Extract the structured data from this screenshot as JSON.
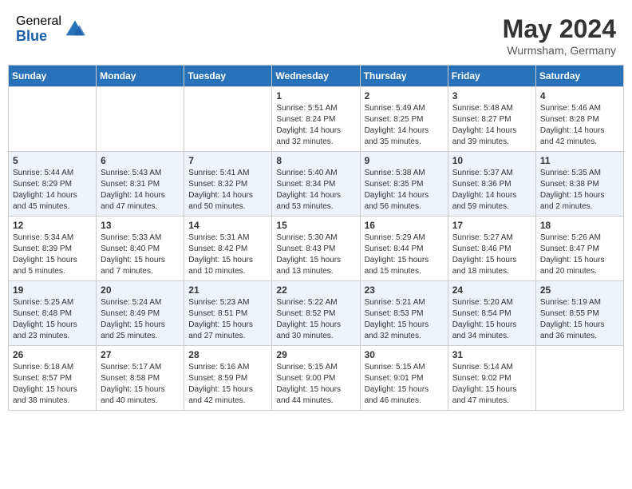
{
  "header": {
    "logo_general": "General",
    "logo_blue": "Blue",
    "month_year": "May 2024",
    "location": "Wurmsham, Germany"
  },
  "weekdays": [
    "Sunday",
    "Monday",
    "Tuesday",
    "Wednesday",
    "Thursday",
    "Friday",
    "Saturday"
  ],
  "weeks": [
    [
      {
        "day": "",
        "info": ""
      },
      {
        "day": "",
        "info": ""
      },
      {
        "day": "",
        "info": ""
      },
      {
        "day": "1",
        "info": "Sunrise: 5:51 AM\nSunset: 8:24 PM\nDaylight: 14 hours\nand 32 minutes."
      },
      {
        "day": "2",
        "info": "Sunrise: 5:49 AM\nSunset: 8:25 PM\nDaylight: 14 hours\nand 35 minutes."
      },
      {
        "day": "3",
        "info": "Sunrise: 5:48 AM\nSunset: 8:27 PM\nDaylight: 14 hours\nand 39 minutes."
      },
      {
        "day": "4",
        "info": "Sunrise: 5:46 AM\nSunset: 8:28 PM\nDaylight: 14 hours\nand 42 minutes."
      }
    ],
    [
      {
        "day": "5",
        "info": "Sunrise: 5:44 AM\nSunset: 8:29 PM\nDaylight: 14 hours\nand 45 minutes."
      },
      {
        "day": "6",
        "info": "Sunrise: 5:43 AM\nSunset: 8:31 PM\nDaylight: 14 hours\nand 47 minutes."
      },
      {
        "day": "7",
        "info": "Sunrise: 5:41 AM\nSunset: 8:32 PM\nDaylight: 14 hours\nand 50 minutes."
      },
      {
        "day": "8",
        "info": "Sunrise: 5:40 AM\nSunset: 8:34 PM\nDaylight: 14 hours\nand 53 minutes."
      },
      {
        "day": "9",
        "info": "Sunrise: 5:38 AM\nSunset: 8:35 PM\nDaylight: 14 hours\nand 56 minutes."
      },
      {
        "day": "10",
        "info": "Sunrise: 5:37 AM\nSunset: 8:36 PM\nDaylight: 14 hours\nand 59 minutes."
      },
      {
        "day": "11",
        "info": "Sunrise: 5:35 AM\nSunset: 8:38 PM\nDaylight: 15 hours\nand 2 minutes."
      }
    ],
    [
      {
        "day": "12",
        "info": "Sunrise: 5:34 AM\nSunset: 8:39 PM\nDaylight: 15 hours\nand 5 minutes."
      },
      {
        "day": "13",
        "info": "Sunrise: 5:33 AM\nSunset: 8:40 PM\nDaylight: 15 hours\nand 7 minutes."
      },
      {
        "day": "14",
        "info": "Sunrise: 5:31 AM\nSunset: 8:42 PM\nDaylight: 15 hours\nand 10 minutes."
      },
      {
        "day": "15",
        "info": "Sunrise: 5:30 AM\nSunset: 8:43 PM\nDaylight: 15 hours\nand 13 minutes."
      },
      {
        "day": "16",
        "info": "Sunrise: 5:29 AM\nSunset: 8:44 PM\nDaylight: 15 hours\nand 15 minutes."
      },
      {
        "day": "17",
        "info": "Sunrise: 5:27 AM\nSunset: 8:46 PM\nDaylight: 15 hours\nand 18 minutes."
      },
      {
        "day": "18",
        "info": "Sunrise: 5:26 AM\nSunset: 8:47 PM\nDaylight: 15 hours\nand 20 minutes."
      }
    ],
    [
      {
        "day": "19",
        "info": "Sunrise: 5:25 AM\nSunset: 8:48 PM\nDaylight: 15 hours\nand 23 minutes."
      },
      {
        "day": "20",
        "info": "Sunrise: 5:24 AM\nSunset: 8:49 PM\nDaylight: 15 hours\nand 25 minutes."
      },
      {
        "day": "21",
        "info": "Sunrise: 5:23 AM\nSunset: 8:51 PM\nDaylight: 15 hours\nand 27 minutes."
      },
      {
        "day": "22",
        "info": "Sunrise: 5:22 AM\nSunset: 8:52 PM\nDaylight: 15 hours\nand 30 minutes."
      },
      {
        "day": "23",
        "info": "Sunrise: 5:21 AM\nSunset: 8:53 PM\nDaylight: 15 hours\nand 32 minutes."
      },
      {
        "day": "24",
        "info": "Sunrise: 5:20 AM\nSunset: 8:54 PM\nDaylight: 15 hours\nand 34 minutes."
      },
      {
        "day": "25",
        "info": "Sunrise: 5:19 AM\nSunset: 8:55 PM\nDaylight: 15 hours\nand 36 minutes."
      }
    ],
    [
      {
        "day": "26",
        "info": "Sunrise: 5:18 AM\nSunset: 8:57 PM\nDaylight: 15 hours\nand 38 minutes."
      },
      {
        "day": "27",
        "info": "Sunrise: 5:17 AM\nSunset: 8:58 PM\nDaylight: 15 hours\nand 40 minutes."
      },
      {
        "day": "28",
        "info": "Sunrise: 5:16 AM\nSunset: 8:59 PM\nDaylight: 15 hours\nand 42 minutes."
      },
      {
        "day": "29",
        "info": "Sunrise: 5:15 AM\nSunset: 9:00 PM\nDaylight: 15 hours\nand 44 minutes."
      },
      {
        "day": "30",
        "info": "Sunrise: 5:15 AM\nSunset: 9:01 PM\nDaylight: 15 hours\nand 46 minutes."
      },
      {
        "day": "31",
        "info": "Sunrise: 5:14 AM\nSunset: 9:02 PM\nDaylight: 15 hours\nand 47 minutes."
      },
      {
        "day": "",
        "info": ""
      }
    ]
  ]
}
